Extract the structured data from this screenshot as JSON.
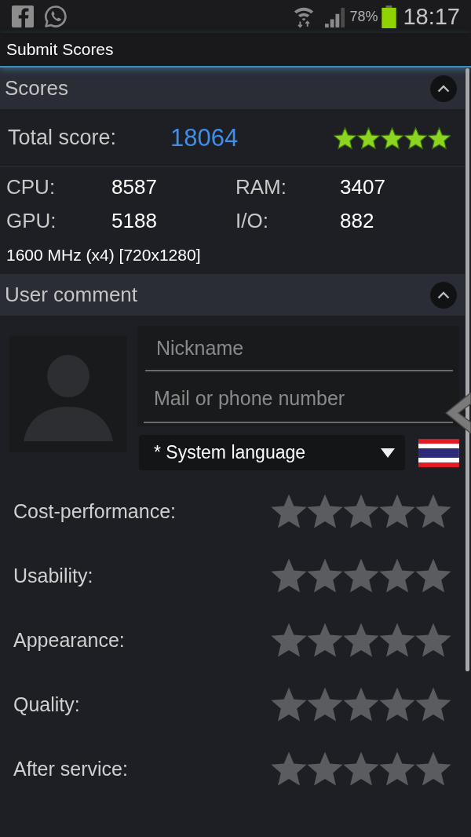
{
  "status_bar": {
    "battery": "78%",
    "time": "18:17"
  },
  "app_bar": {
    "title": "Submit Scores"
  },
  "scores_section": {
    "title": "Scores",
    "expanded": true,
    "total_label": "Total score:",
    "total_value": "18064",
    "stars": 5,
    "metrics": [
      {
        "label": "CPU:",
        "value": "8587"
      },
      {
        "label": "RAM:",
        "value": "3407"
      },
      {
        "label": "GPU:",
        "value": "5188"
      },
      {
        "label": "I/O:",
        "value": "882"
      }
    ],
    "device_info": "1600 MHz (x4) [720x1280]"
  },
  "comment_section": {
    "title": "User comment",
    "expanded": true,
    "fields": [
      {
        "placeholder": "Nickname"
      },
      {
        "placeholder": "Mail or phone number"
      }
    ],
    "language": {
      "value": "* System language"
    },
    "ratings": [
      {
        "label": "Cost-performance:",
        "stars": 0
      },
      {
        "label": "Usability:",
        "stars": 0
      },
      {
        "label": "Appearance:",
        "stars": 0
      },
      {
        "label": "Quality:",
        "stars": 0
      },
      {
        "label": "After service:",
        "stars": 0
      }
    ]
  }
}
